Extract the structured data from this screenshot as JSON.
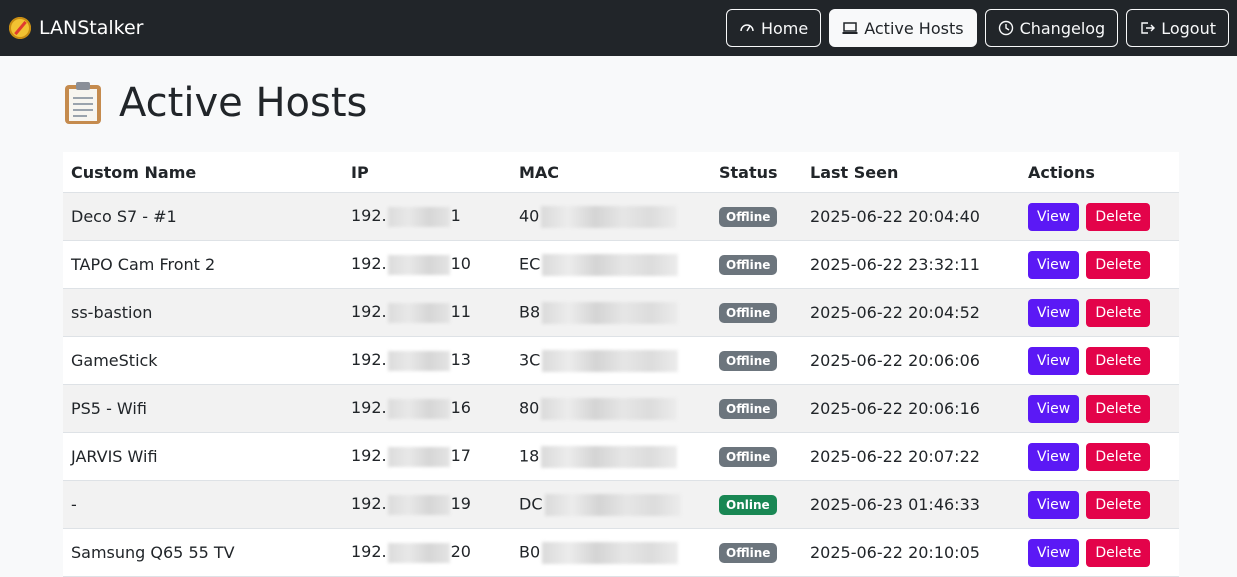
{
  "brand": {
    "title": "LANStalker"
  },
  "nav": {
    "home": "Home",
    "active_hosts": "Active Hosts",
    "changelog": "Changelog",
    "logout": "Logout"
  },
  "page": {
    "title": "Active Hosts"
  },
  "table": {
    "headers": [
      "Custom Name",
      "IP",
      "MAC",
      "Status",
      "Last Seen",
      "Actions"
    ],
    "rows": [
      {
        "name": "Deco S7 - #1",
        "ip_prefix": "192.",
        "ip_suffix": "1",
        "mac_prefix": "40",
        "status": "Offline",
        "last_seen": "2025-06-22 20:04:40"
      },
      {
        "name": "TAPO Cam Front 2",
        "ip_prefix": "192.",
        "ip_suffix": "10",
        "mac_prefix": "EC",
        "status": "Offline",
        "last_seen": "2025-06-22 23:32:11"
      },
      {
        "name": "ss-bastion",
        "ip_prefix": "192.",
        "ip_suffix": "11",
        "mac_prefix": "B8",
        "status": "Offline",
        "last_seen": "2025-06-22 20:04:52"
      },
      {
        "name": "GameStick",
        "ip_prefix": "192.",
        "ip_suffix": "13",
        "mac_prefix": "3C",
        "status": "Offline",
        "last_seen": "2025-06-22 20:06:06"
      },
      {
        "name": "PS5 - Wifi",
        "ip_prefix": "192.",
        "ip_suffix": "16",
        "mac_prefix": "80",
        "status": "Offline",
        "last_seen": "2025-06-22 20:06:16"
      },
      {
        "name": "JARVIS Wifi",
        "ip_prefix": "192.",
        "ip_suffix": "17",
        "mac_prefix": "18",
        "status": "Offline",
        "last_seen": "2025-06-22 20:07:22"
      },
      {
        "name": "-",
        "ip_prefix": "192.",
        "ip_suffix": "19",
        "mac_prefix": "DC",
        "status": "Online",
        "last_seen": "2025-06-23 01:46:33"
      },
      {
        "name": "Samsung Q65 55 TV",
        "ip_prefix": "192.",
        "ip_suffix": "20",
        "mac_prefix": "B0",
        "status": "Offline",
        "last_seen": "2025-06-22 20:10:05"
      }
    ],
    "view_label": "View",
    "delete_label": "Delete"
  },
  "colors": {
    "navbar_bg": "#212529",
    "view_button": "#5b19f5",
    "delete_button": "#e3034a",
    "offline_badge": "#6c757d",
    "online_badge": "#198754"
  }
}
